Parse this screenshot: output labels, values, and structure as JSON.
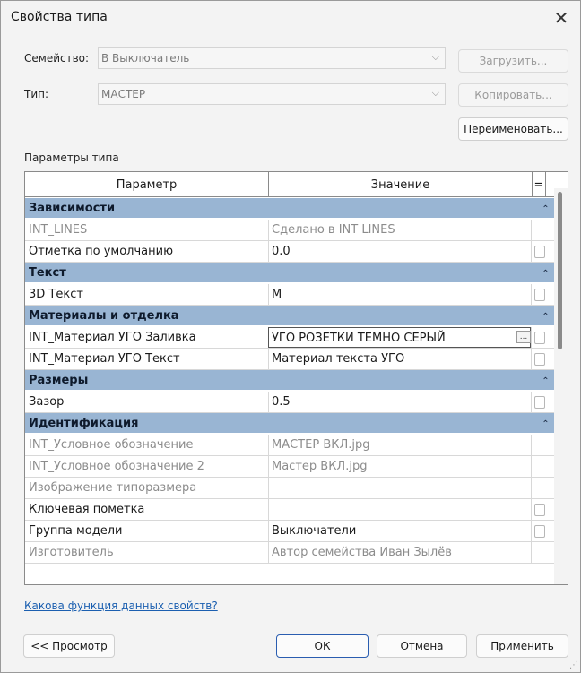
{
  "window": {
    "title": "Свойства типа",
    "close_glyph": "✕"
  },
  "family": {
    "label": "Семейство:",
    "value": "В Выключатель",
    "load_button": "Загрузить..."
  },
  "type": {
    "label": "Тип:",
    "value": "МАСТЕР",
    "duplicate_button": "Копировать...",
    "rename_button": "Переименовать..."
  },
  "params": {
    "caption": "Параметры типа",
    "col_param": "Параметр",
    "col_value": "Значение",
    "col_eq": "=",
    "groups": [
      {
        "name": "Зависимости",
        "rows": [
          {
            "name": "INT_LINES",
            "value": "Сделано в INT LINES",
            "gray": true,
            "check": false
          },
          {
            "name": "Отметка по умолчанию",
            "value": "0.0",
            "gray": false,
            "check": true
          }
        ]
      },
      {
        "name": "Текст",
        "rows": [
          {
            "name": "3D Текст",
            "value": "М",
            "gray": false,
            "check": true
          }
        ]
      },
      {
        "name": "Материалы и отделка",
        "rows": [
          {
            "name": "INT_Материал УГО Заливка",
            "value": "УГО РОЗЕТКИ ТЕМНО СЕРЫЙ",
            "gray": false,
            "check": true,
            "active": true
          },
          {
            "name": "INT_Материал УГО Текст",
            "value": "Материал текста УГО",
            "gray": false,
            "check": true
          }
        ]
      },
      {
        "name": "Размеры",
        "rows": [
          {
            "name": "Зазор",
            "value": "0.5",
            "gray": false,
            "check": true
          }
        ]
      },
      {
        "name": "Идентификация",
        "rows": [
          {
            "name": "INT_Условное обозначение",
            "value": "МАСТЕР ВКЛ.jpg",
            "gray": true,
            "check": false
          },
          {
            "name": "INT_Условное обозначение 2",
            "value": "Мастер ВКЛ.jpg",
            "gray": true,
            "check": false
          },
          {
            "name": "Изображение типоразмера",
            "value": "",
            "gray": true,
            "check": false
          },
          {
            "name": "Ключевая пометка",
            "value": "",
            "gray": false,
            "check": true
          },
          {
            "name": "Группа модели",
            "value": "Выключатели",
            "gray": false,
            "check": true
          },
          {
            "name": "Изготовитель",
            "value": "Автор семейства Иван Зылёв",
            "gray": true,
            "check": false
          }
        ]
      }
    ],
    "collapse_glyph": "⌃",
    "ellipsis_glyph": "..."
  },
  "help_link": "Какова функция данных свойств?",
  "footer": {
    "preview_button": "<< Просмотр",
    "ok_button": "ОК",
    "cancel_button": "Отмена",
    "apply_button": "Применить"
  },
  "icons": {
    "close": "close-icon",
    "dropdown": "chevron-down-icon",
    "collapse": "collapse-group-icon"
  },
  "colors": {
    "group_header": "#99b5d3",
    "link": "#1b5fb0",
    "primary_border": "#2a5db0"
  }
}
